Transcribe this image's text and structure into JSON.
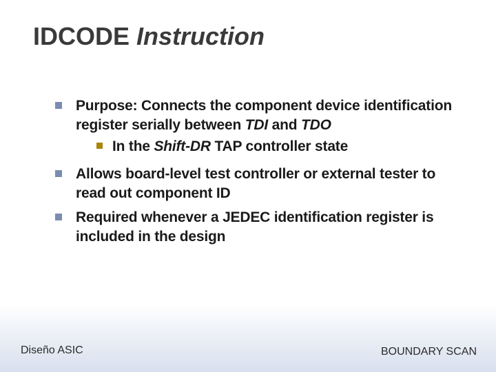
{
  "title": {
    "word1": "IDCODE",
    "word2": "Instruction"
  },
  "bullets": [
    {
      "pre": "Purpose: Connects the component device identification register serially between ",
      "it1": "TDI",
      "mid": " and ",
      "it2": "TDO",
      "post": ""
    },
    {
      "sub": true,
      "pre": "In the ",
      "it1": "Shift-DR",
      "post": " TAP controller state"
    },
    {
      "pre": "Allows board-level test controller or external tester to read out component ID"
    },
    {
      "pre": "Required whenever a JEDEC identification register is included in the design"
    }
  ],
  "footer": {
    "left": "Diseño ASIC",
    "right": "BOUNDARY SCAN"
  }
}
